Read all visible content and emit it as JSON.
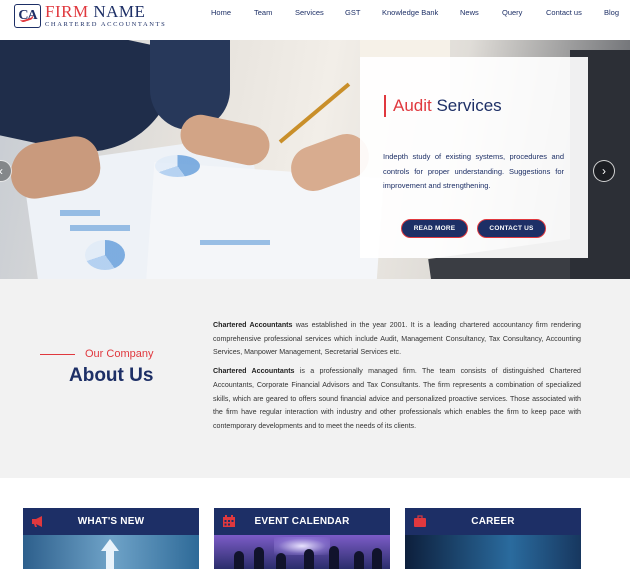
{
  "brand": {
    "logo_mark": "CA",
    "name_part1": "FIRM",
    "name_part2": " NAME",
    "subtitle": "CHARTERED ACCOUNTANTS"
  },
  "nav": {
    "items": [
      {
        "label": "Home"
      },
      {
        "label": "Team"
      },
      {
        "label": "Services"
      },
      {
        "label": "GST"
      },
      {
        "label": "Knowledge Bank"
      },
      {
        "label": "News"
      },
      {
        "label": "Query"
      },
      {
        "label": "Contact us"
      },
      {
        "label": "Blog"
      }
    ]
  },
  "hero": {
    "title_accent": "Audit",
    "title_rest": " Services",
    "description": "Indepth study of existing systems, procedures and controls for proper understanding. Suggestions for improvement and strengthening.",
    "read_more": "READ MORE",
    "contact_us": "CONTACT US",
    "prev_icon": "chevron-left-icon",
    "next_icon": "chevron-right-icon",
    "arrow_prev": "‹",
    "arrow_next": "›"
  },
  "about": {
    "kicker": "Our Company",
    "heading": "About Us",
    "para1_bold": "Chartered Accountants",
    "para1_rest": " was established in the year 2001. It is a leading chartered accountancy firm rendering comprehensive professional services which include Audit, Management Consultancy, Tax Consultancy, Accounting Services, Manpower Management, Secretarial Services etc.",
    "para2_bold": "Chartered Accountants",
    "para2_rest": " is a professionally managed firm. The team consists of distinguished Chartered Accountants, Corporate Financial Advisors and Tax Consultants. The firm represents a combination of specialized skills, which are geared to offers sound financial advice and personalized proactive services. Those associated with the firm have regular interaction with industry and other professionals which enables the firm to keep pace with contemporary developments and to meet the needs of its clients."
  },
  "cards": [
    {
      "label": "WHAT'S NEW",
      "icon": "megaphone-icon"
    },
    {
      "label": "EVENT CALENDAR",
      "icon": "calendar-icon"
    },
    {
      "label": "CAREER",
      "icon": "briefcase-icon"
    }
  ],
  "colors": {
    "navy": "#1d2f66",
    "accent_red": "#e0383e",
    "about_bg": "#f2f2f2"
  }
}
